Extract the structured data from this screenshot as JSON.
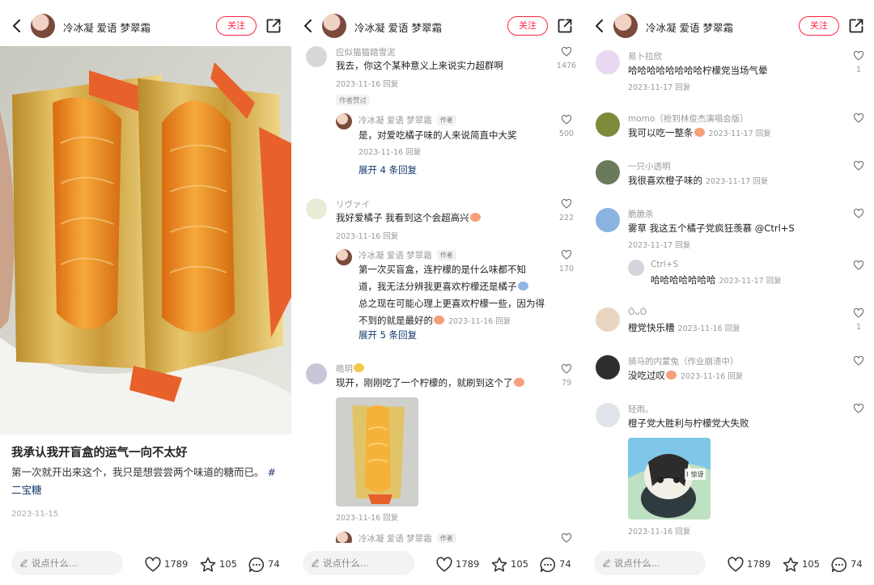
{
  "header": {
    "username": "冷冰凝 爱语 梦翠霜",
    "follow_label": "关注"
  },
  "post": {
    "title": "我承认我开盲盒的运气一向不太好",
    "desc": "第一次就开出来这个，我只是想尝尝两个味道的糖而已。",
    "hashtag": "#二宝糖",
    "date": "2023-11-15"
  },
  "bottom": {
    "placeholder": "说点什么...",
    "likes": "1789",
    "favorites": "105",
    "comments": "74"
  },
  "panel2": {
    "c1": {
      "name": "应似猫猫踏雪泥",
      "text": "我去，你这个某种意义上来说实力超群啊",
      "meta": "2023-11-16 回复",
      "badge": "作者赞过",
      "likes": "1476"
    },
    "r1": {
      "name": "冷冰凝 爱语 梦翠霜",
      "tag": "作者",
      "text": "是，对爱吃橘子味的人来说简直中大奖",
      "meta": "2023-11-16 回复",
      "likes": "500"
    },
    "x1": "展开 4 条回复",
    "c2": {
      "name": "リヴァイ",
      "text": "我好爱橘子 我看到这个会超高兴",
      "meta": "2023-11-16 回复",
      "likes": "222"
    },
    "r2": {
      "name": "冷冰凝 爱语 梦翠霜",
      "tag": "作者",
      "line1": "第一次买盲盒，连柠檬的是什么味都不知",
      "line2": "道，我无法分辨我更喜欢柠檬还是橘子",
      "line3": "总之现在可能心理上更喜欢柠檬一些，因为得",
      "line4": "不到的就是最好的",
      "meta": "2023-11-16 回复",
      "likes": "170"
    },
    "x2": "展开 5 条回复",
    "c3": {
      "name": "皓玥",
      "text": "现开，刚刚吃了一个柠檬的，就刷到这个了",
      "meta": "2023-11-16 回复",
      "likes": "79"
    },
    "r3": {
      "name": "冷冰凝 爱语 梦翠霜",
      "tag": "作者"
    }
  },
  "panel3": {
    "c1": {
      "name": "易卜拉欣",
      "text": "哈哈哈哈哈哈哈哈柠檬党当场气晕",
      "meta": "2023-11-17 回复",
      "likes": "1"
    },
    "c2": {
      "name": "momo（抢到林俊杰演唱会版）",
      "text": "我可以吃一整条",
      "meta": "2023-11-17 回复"
    },
    "c3": {
      "name": "一只小透明",
      "text": "我很喜欢橙子味的",
      "meta": "2023-11-17 回复"
    },
    "c4": {
      "name": "脆脆杀",
      "text": "雾草 我这五个橘子党疯狂羡慕 @Ctrl+S",
      "meta": "2023-11-17 回复"
    },
    "r4": {
      "name": "Ctrl+S",
      "text": "哈哈哈哈哈哈哈",
      "meta": "2023-11-17 回复"
    },
    "c5": {
      "name": "ÒᴗÓ",
      "text": "橙党快乐糟",
      "meta": "2023-11-16 回复",
      "likes": "1"
    },
    "c6": {
      "name": "骑马的内蒙兔（作业崩溃中）",
      "text": "没吃过叹",
      "meta": "2023-11-16 回复"
    },
    "c7": {
      "name": "轻雨。",
      "text": "橙子党大胜利与柠檬党大失败",
      "meta": "2023-11-16 回复",
      "sticker": "I 惊讶"
    }
  }
}
